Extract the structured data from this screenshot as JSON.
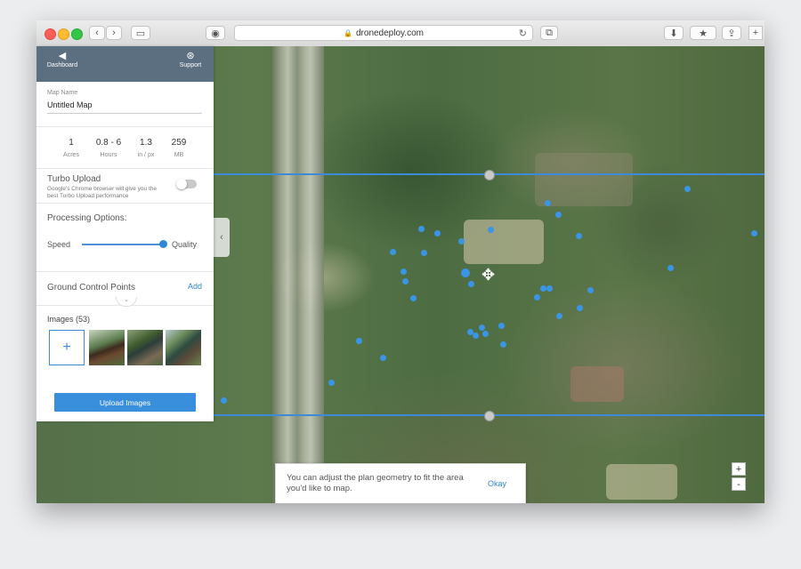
{
  "browser": {
    "url": "dronedeploy.com"
  },
  "sidebar": {
    "nav": {
      "dashboard_label": "Dashboard",
      "support_label": "Support"
    },
    "map_name": {
      "label": "Map Name",
      "value": "Untitled Map"
    },
    "stats": [
      {
        "value": "1",
        "unit": "Acres"
      },
      {
        "value": "0.8 - 6",
        "unit": "Hours"
      },
      {
        "value": "1.3",
        "unit": "in / px"
      },
      {
        "value": "259",
        "unit": "MB"
      }
    ],
    "turbo_upload": {
      "title": "Turbo Upload",
      "description": "Google's Chrome browser will give you the best Turbo Upload performance",
      "enabled": false
    },
    "processing": {
      "title": "Processing Options:",
      "speed_label": "Speed",
      "quality_label": "Quality",
      "slider_value": 1.0
    },
    "gcp": {
      "title": "Ground Control Points",
      "add_label": "Add"
    },
    "images": {
      "title": "Images (53)",
      "add_symbol": "+"
    },
    "upload_button": "Upload Images"
  },
  "toast": {
    "message": "You can adjust the plan geometry to fit the area you'd like to map.",
    "ok_label": "Okay"
  },
  "zoom": {
    "in": "+",
    "out": "-"
  },
  "colors": {
    "accent": "#3a8fdc",
    "header": "#5c6f80",
    "boundary": "#3c8ad8"
  }
}
